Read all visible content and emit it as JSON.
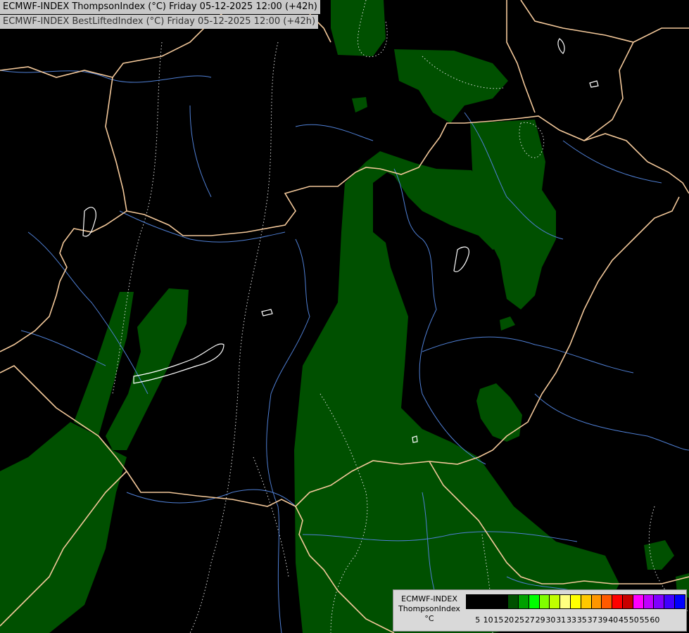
{
  "titles": {
    "line1": "ECMWF-INDEX ThompsonIndex (°C) Friday 05-12-2025 12:00 (+42h)",
    "line2": "ECMWF-INDEX BestLiftedIndex (°C) Friday 05-12-2025 12:00 (+42h)"
  },
  "legend": {
    "model": "ECMWF-INDEX",
    "parameter": "ThompsonIndex",
    "unit": "°C",
    "ticks": [
      "5",
      "10",
      "15",
      "20",
      "25",
      "27",
      "29",
      "30",
      "31",
      "33",
      "35",
      "37",
      "39",
      "40",
      "45",
      "50",
      "55",
      "60"
    ],
    "colors": [
      "#000000",
      "#000000",
      "#000000",
      "#000000",
      "#005000",
      "#00a000",
      "#00ff00",
      "#80ff00",
      "#c0ff00",
      "#ffff80",
      "#ffff00",
      "#ffc800",
      "#ff9600",
      "#ff5a00",
      "#ff0000",
      "#c80000",
      "#ff00ff",
      "#c000ff",
      "#8000ff",
      "#4000ff",
      "#0000ff"
    ]
  },
  "colors": {
    "fill_zone": "#005000",
    "borders": "#f3c89a",
    "rivers": "#4f7fd4",
    "isolines": "#dddddd"
  }
}
